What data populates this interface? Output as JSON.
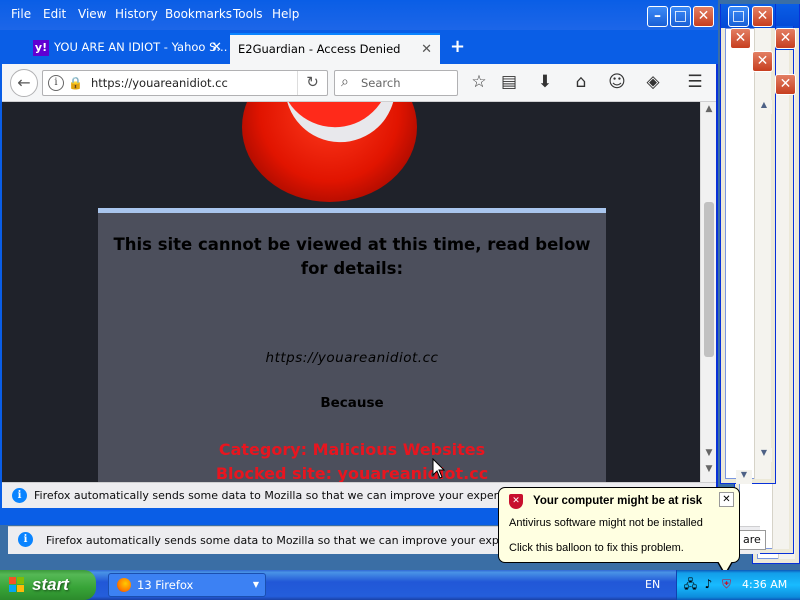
{
  "menubar": {
    "items": [
      "File",
      "Edit",
      "View",
      "History",
      "Bookmarks",
      "Tools",
      "Help"
    ]
  },
  "tabs": [
    {
      "label": "YOU ARE AN IDIOT - Yahoo S...",
      "favicon": "y!",
      "active": false
    },
    {
      "label": "E2Guardian - Access Denied",
      "active": true
    }
  ],
  "navbar": {
    "url": "https://youareanidiot.cc",
    "search_placeholder": "Search"
  },
  "page": {
    "heading": "This site cannot be viewed at this time, read below for details:",
    "blocked_url": "https://youareanidiot.cc",
    "because_label": "Because",
    "category": "Category: Malicious Websites",
    "blocked_site": "Blocked site: youareanidiot.cc"
  },
  "notifications": [
    {
      "text": "Firefox automatically sends some data to Mozilla so that we can improve your experience."
    },
    {
      "text": "Firefox automatically sends some data to Mozilla so that we can improve your experience."
    }
  ],
  "partial_button_text": "are",
  "balloon": {
    "title": "Your computer might be at risk",
    "line1": "Antivirus software might not be installed",
    "line2": "Click this balloon to fix this problem."
  },
  "taskbar": {
    "start_label": "start",
    "task_label": "13 Firefox",
    "language": "EN",
    "clock": "4:36 AM"
  },
  "colors": {
    "xp_blue": "#0a5ee6",
    "blocked_red": "#e8151f",
    "panel_bg": "#4c4f5c",
    "page_bg": "#1f222a"
  }
}
